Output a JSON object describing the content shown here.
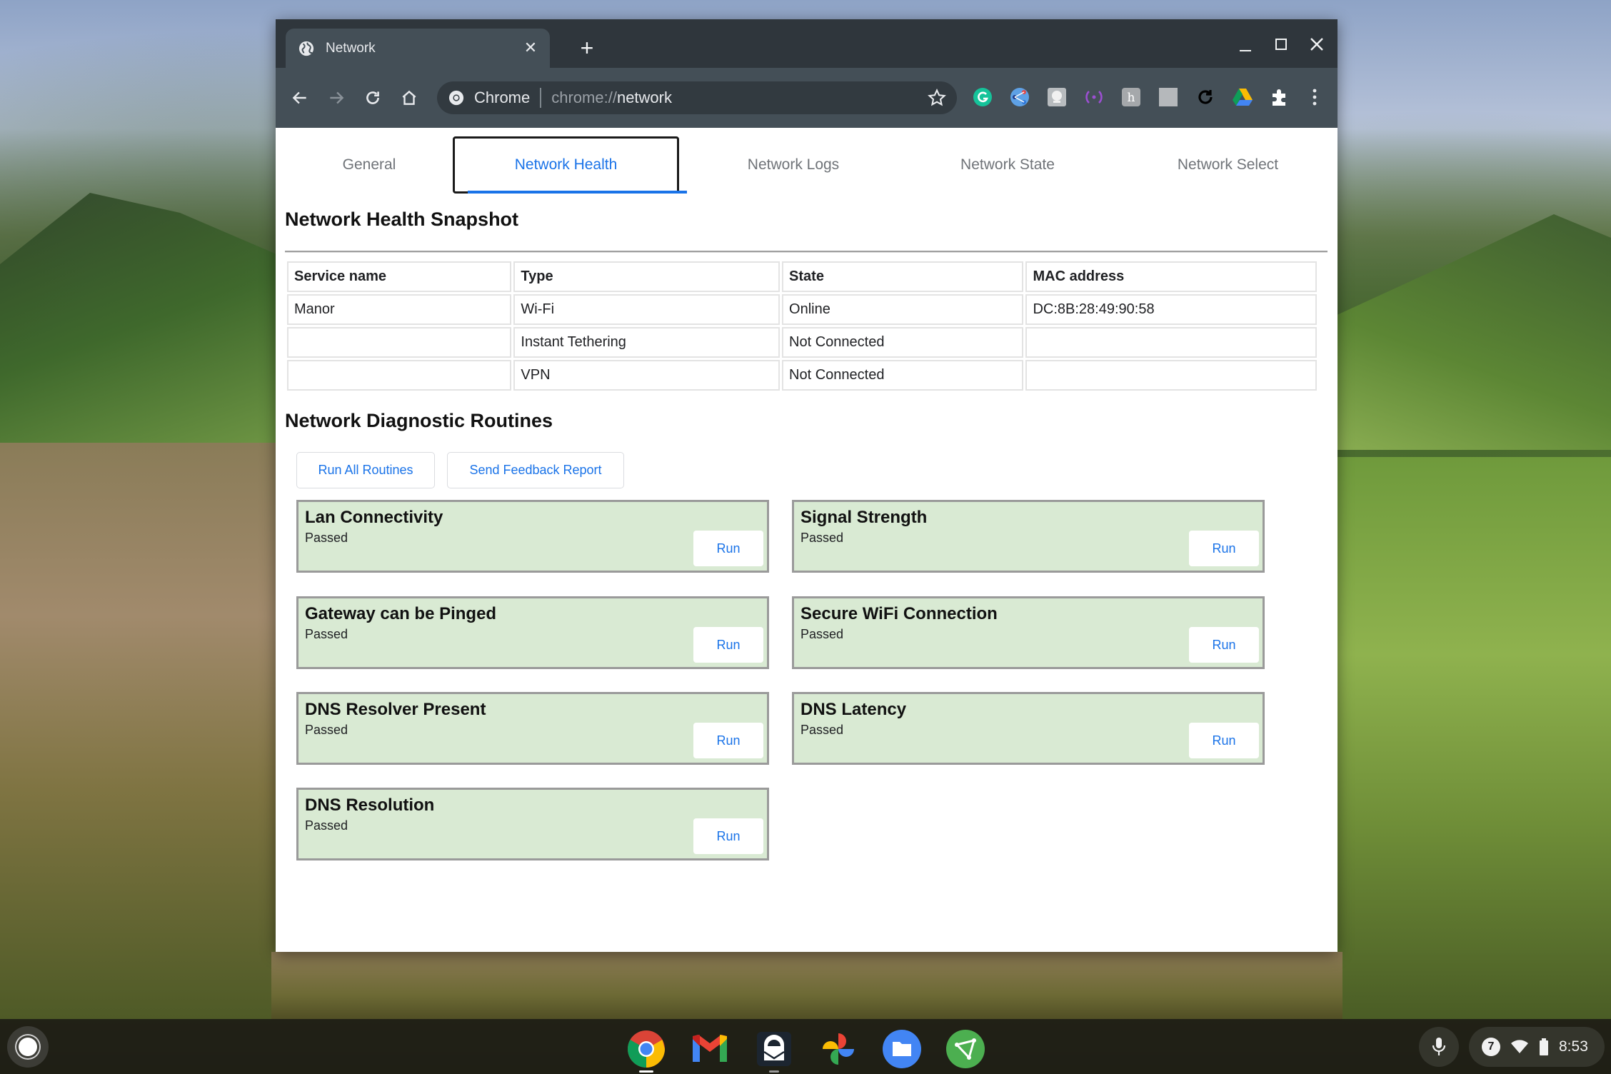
{
  "browser": {
    "tab_title": "Network",
    "omnibox_label": "Chrome",
    "url_scheme": "chrome://",
    "url_host": "network",
    "extensions": [
      "grammarly-icon",
      "share-extension-icon",
      "screenshot-extension-icon",
      "broadcast-extension-icon",
      "honey-extension-icon",
      "blank-extension-icon",
      "refresh-extension-icon",
      "google-drive-icon",
      "extensions-puzzle-icon"
    ]
  },
  "page": {
    "tabs": [
      {
        "label": "General",
        "active": false
      },
      {
        "label": "Network Health",
        "active": true
      },
      {
        "label": "Network Logs",
        "active": false
      },
      {
        "label": "Network State",
        "active": false
      },
      {
        "label": "Network Select",
        "active": false
      }
    ],
    "snapshot": {
      "title": "Network Health Snapshot",
      "columns": [
        "Service name",
        "Type",
        "State",
        "MAC address"
      ],
      "rows": [
        [
          "Manor",
          "Wi-Fi",
          "Online",
          "DC:8B:28:49:90:58"
        ],
        [
          "",
          "Instant Tethering",
          "Not Connected",
          ""
        ],
        [
          "",
          "VPN",
          "Not Connected",
          ""
        ]
      ]
    },
    "routines": {
      "title": "Network Diagnostic Routines",
      "run_all_label": "Run All Routines",
      "feedback_label": "Send Feedback Report",
      "run_label": "Run",
      "items": [
        {
          "name": "Lan Connectivity",
          "result": "Passed"
        },
        {
          "name": "Signal Strength",
          "result": "Passed"
        },
        {
          "name": "Gateway can be Pinged",
          "result": "Passed"
        },
        {
          "name": "Secure WiFi Connection",
          "result": "Passed"
        },
        {
          "name": "DNS Resolver Present",
          "result": "Passed"
        },
        {
          "name": "DNS Latency",
          "result": "Passed"
        },
        {
          "name": "DNS Resolution",
          "result": "Passed"
        }
      ]
    }
  },
  "shelf": {
    "apps": [
      "chrome",
      "gmail",
      "protonmail",
      "google-photos",
      "files",
      "app-green"
    ],
    "notification_count": "7",
    "time": "8:53"
  },
  "colors": {
    "accent": "#1a73e8",
    "routine_pass_bg": "#d9ead3",
    "routine_border": "#9a9a9a",
    "toolbar": "#444f57",
    "tabstrip": "#2f363c"
  }
}
